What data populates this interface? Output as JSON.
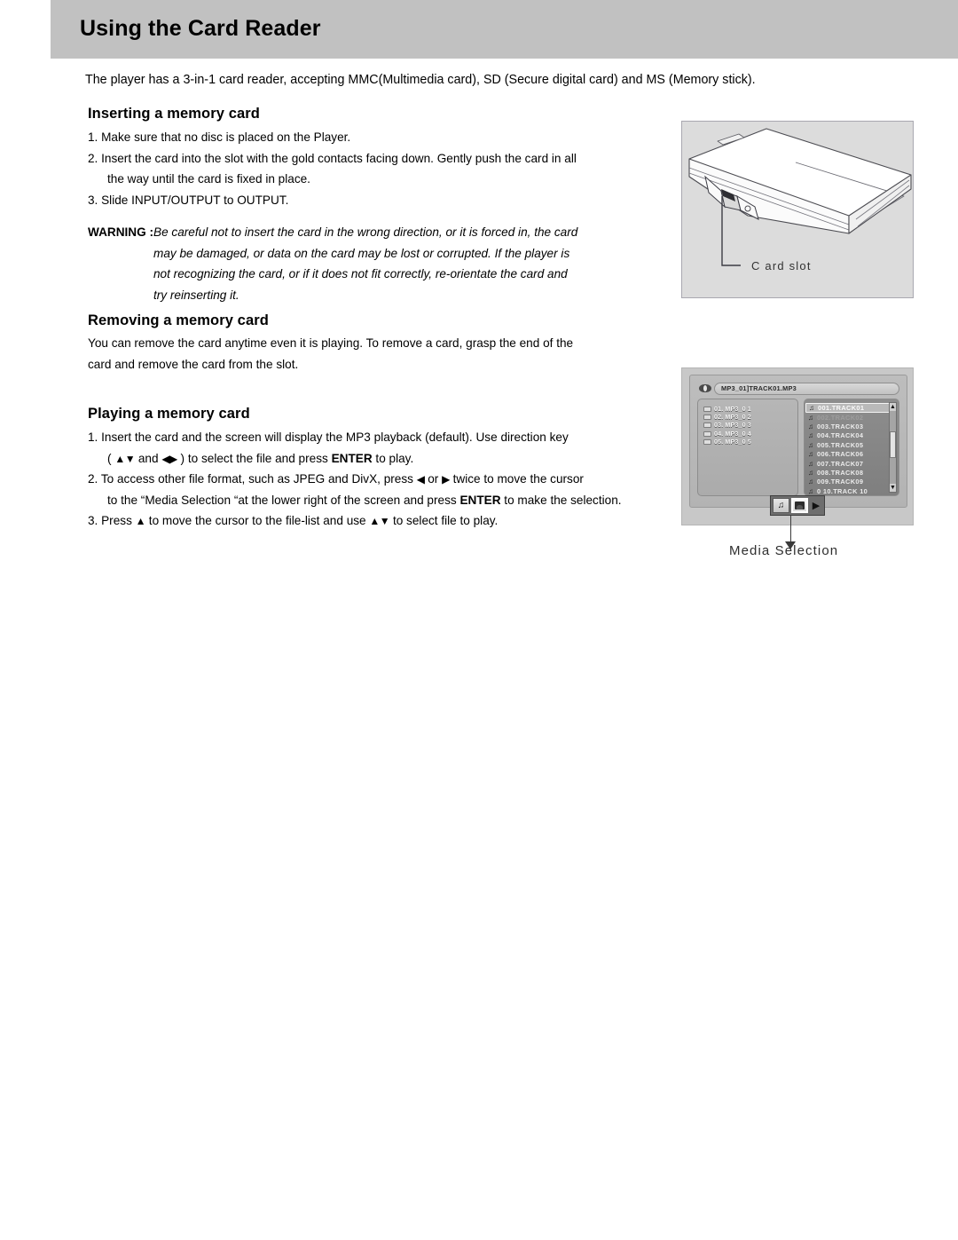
{
  "header": {
    "title": "Using the Card Reader",
    "band_color": "#c1c1c1"
  },
  "intro": "The player has a 3-in-1 card reader, accepting MMC(Multimedia card), SD (Secure digital card) and MS (Memory stick).",
  "sections": {
    "inserting": {
      "heading": "Inserting a memory card",
      "steps": [
        "1. Make sure that no disc is placed on the Player.",
        "2. Insert the card into the slot with the gold contacts facing down. Gently push the card in all",
        "the way until the card is fixed in place.",
        "3. Slide INPUT/OUTPUT to OUTPUT."
      ]
    },
    "warning": {
      "label": "WARNING :",
      "lines": [
        "Be careful not to insert the card in the wrong direction, or it is forced in, the card",
        "may be damaged, or data on the card may be lost or corrupted. If the player is",
        "not recognizing the card, or if it does not fit correctly, re-orientate the card and",
        "try reinserting it."
      ]
    },
    "removing": {
      "heading": "Removing a memory card",
      "lines": [
        "You can remove the card anytime even it is playing. To remove a card, grasp the end of the",
        "card and remove the card from the slot."
      ]
    },
    "playing": {
      "heading": "Playing a memory card",
      "step1_a": "1. Insert the card and the screen will display the MP3 playback (default). Use direction key",
      "step1_b_pre": "( ",
      "step1_b_ud": "▲▼",
      "step1_b_and": " and ",
      "step1_b_lr": "◀▶",
      "step1_b_mid": " ) to select the file and press ",
      "step1_b_enter": "ENTER",
      "step1_b_end": " to play.",
      "step2_a_pre": "2. To access other file format, such as JPEG and DivX, press ",
      "step2_a_left": "◀",
      "step2_a_or": " or ",
      "step2_a_right": "▶",
      "step2_a_end": " twice to move the cursor",
      "step2_b_pre": "to the “Media Selection “at the lower right of the screen and press ",
      "step2_b_enter": "ENTER",
      "step2_b_end": " to make the selection.",
      "step3_pre": "3. Press ",
      "step3_up": "▲",
      "step3_mid": "  to move the cursor to the file-list and use  ",
      "step3_ud": "▲▼",
      "step3_end": " to select file to play."
    }
  },
  "figures": {
    "card_slot": {
      "caption": "C ard slot"
    },
    "osd": {
      "path": "MP3_01]TRACK01.MP3",
      "folders": [
        "01. MP3_0 1",
        "02. MP3_0 2",
        "03. MP3_0 3",
        "04. MP3_0 4",
        "05. MP3_0 5"
      ],
      "tracks": [
        "001.TRACK01",
        "002.TRACK02",
        "003.TRACK03",
        "004.TRACK04",
        "005.TRACK05",
        "006.TRACK06",
        "007.TRACK07",
        "008.TRACK08",
        "009.TRACK09",
        "0 10.TRACK 10"
      ],
      "selected_track_index": 0,
      "media_buttons": [
        {
          "name": "music-mode",
          "glyph": "♫",
          "active": false
        },
        {
          "name": "photo-mode",
          "glyph": "",
          "active": true
        },
        {
          "name": "play-mode",
          "glyph": "▶",
          "active": false
        }
      ],
      "scroll_up": "▲",
      "scroll_down": "▼",
      "caption": "Media Selection"
    }
  }
}
